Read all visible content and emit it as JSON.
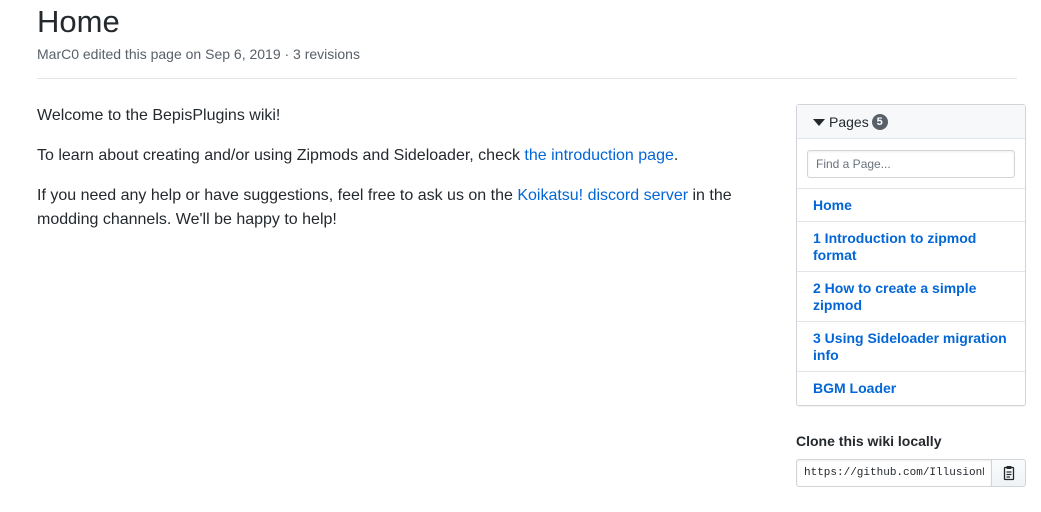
{
  "page": {
    "title": "Home",
    "meta": "MarC0 edited this page on Sep 6, 2019 · 3 revisions"
  },
  "content": {
    "p1": "Welcome to the BepisPlugins wiki!",
    "p2_before": "To learn about creating and/or using Zipmods and Sideloader, check ",
    "p2_link": "the introduction page",
    "p2_after": ".",
    "p3_before": "If you need any help or have suggestions, feel free to ask us on the ",
    "p3_link": "Koikatsu! discord server",
    "p3_after": " in the modding channels. We'll be happy to help!"
  },
  "sidebar": {
    "pages_label": "Pages",
    "pages_count": "5",
    "filter_placeholder": "Find a Page...",
    "items": [
      {
        "label": "Home"
      },
      {
        "label": "1 Introduction to zipmod format"
      },
      {
        "label": "2 How to create a simple zipmod"
      },
      {
        "label": "3 Using Sideloader migration info"
      },
      {
        "label": "BGM Loader"
      }
    ],
    "clone_heading": "Clone this wiki locally",
    "clone_url": "https://github.com/IllusionMods/BepisPlugins.wiki.git"
  },
  "colors": {
    "link": "#0366d6",
    "text": "#24292e",
    "muted": "#586069"
  },
  "icons": {
    "pages_toggle": "triangle-down-icon",
    "copy": "clipboard-icon"
  }
}
